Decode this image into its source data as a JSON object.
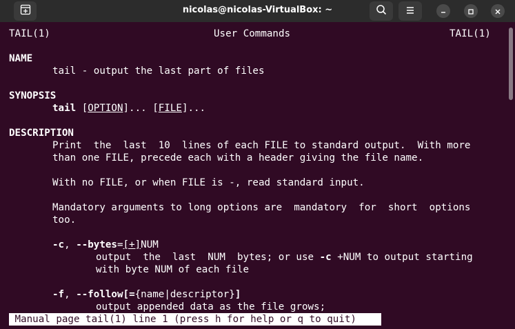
{
  "window": {
    "title": "nicolas@nicolas-VirtualBox: ~"
  },
  "icons": {
    "new_tab": "new-tab-icon",
    "search": "search-icon",
    "menu": "hamburger-menu-icon",
    "minimize": "minimize-icon",
    "maximize": "maximize-icon",
    "close": "close-icon"
  },
  "colors": {
    "terminal_bg": "#300a24",
    "titlebar_bg": "#2c2c2c",
    "text": "#ffffff"
  },
  "man": {
    "header_left": "TAIL(1)",
    "header_center": "User Commands",
    "header_right": "TAIL(1)",
    "name_heading": "NAME",
    "name_text": "tail - output the last part of files",
    "synopsis_heading": "SYNOPSIS",
    "synopsis_cmd": "tail",
    "synopsis_open1": "[",
    "synopsis_option": "OPTION",
    "synopsis_close1": "]... [",
    "synopsis_file": "FILE",
    "synopsis_close2": "]...",
    "description_heading": "DESCRIPTION",
    "desc_line1": "Print  the  last  10  lines of each FILE to standard output.  With more",
    "desc_line2": "than one FILE, precede each with a header giving the file name.",
    "desc_line3": "With no FILE, or when FILE is -, read standard input.",
    "desc_line4": "Mandatory arguments to long options are  mandatory  for  short  options",
    "desc_line5": "too.",
    "opt_c_short": "-c",
    "opt_c_sep": ", ",
    "opt_c_long": "--bytes",
    "opt_c_eq": "=",
    "opt_c_plus": "[+]",
    "opt_c_arg": "NUM",
    "opt_c_desc1_a": "output  the  last  NUM  bytes; or use ",
    "opt_c_desc1_b": "-c",
    "opt_c_desc1_c": " +NUM to output starting",
    "opt_c_desc2": "with byte NUM of each file",
    "opt_f_short": "-f",
    "opt_f_sep": ", ",
    "opt_f_long": "--follow",
    "opt_f_bracket": "[=",
    "opt_f_arg": "{name|descriptor}",
    "opt_f_close": "]",
    "opt_f_desc1": "output appended data as the file grows;"
  },
  "status": {
    "text": " Manual page tail(1) line 1 (press h for help or q to quit)"
  }
}
